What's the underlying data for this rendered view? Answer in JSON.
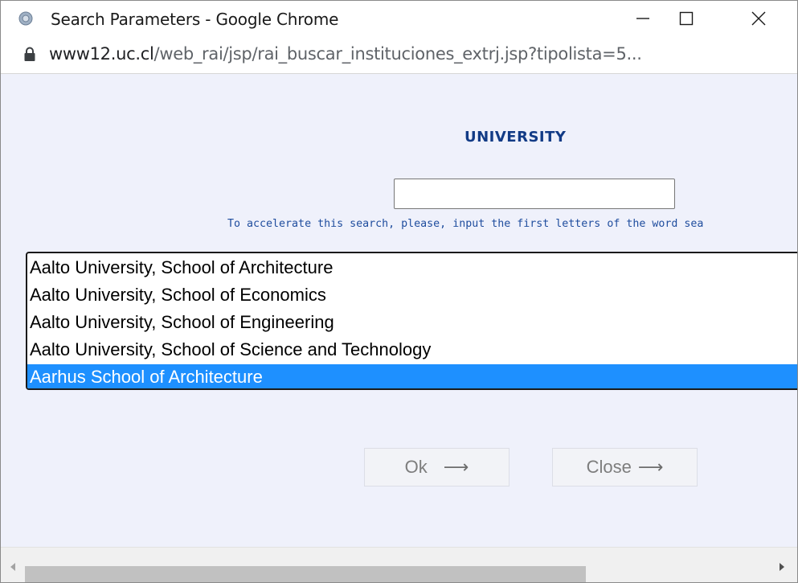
{
  "window": {
    "title": "Search Parameters - Google Chrome",
    "app_icon": "chrome-favicon-icon",
    "controls": [
      "minimize-icon",
      "maximize-icon",
      "close-icon"
    ]
  },
  "address_bar": {
    "lock_icon": "lock-icon",
    "url_host": "www12.uc.cl",
    "url_path": "/web_rai/jsp/rai_buscar_instituciones_extrj.jsp?tipolista=5..."
  },
  "page": {
    "heading": "UNIVERSITY",
    "search_value": "",
    "hint": "To accelerate this search, please, input the first letters of the word sea",
    "list_items": [
      "Aalto University, School of Architecture",
      "Aalto University, School of Economics",
      "Aalto University, School of Engineering",
      "Aalto University, School of Science and Technology",
      "Aarhus School of Architecture"
    ],
    "selected_item": "Aarhus School of Architecture",
    "ok_label": "Ok",
    "close_label": "Close",
    "arrow_glyph": "⟶",
    "arrow_icon": "right-arrow-icon"
  },
  "colors": {
    "content_background": "#eff1fb",
    "heading": "#123b86",
    "hint": "#1f4d9e",
    "selection": "#1e90ff"
  }
}
